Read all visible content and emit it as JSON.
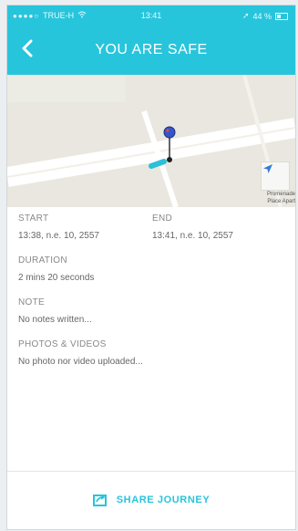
{
  "theme": {
    "accent": "#27c5dc"
  },
  "status_bar": {
    "carrier": "TRUE-H",
    "time": "13:41",
    "battery": "44 %"
  },
  "header": {
    "title": "YOU ARE SAFE"
  },
  "map": {
    "caption_line1": "Promenade",
    "caption_line2": "Place Apart"
  },
  "details": {
    "start_label": "START",
    "start_value": "13:38, n.e. 10, 2557",
    "end_label": "END",
    "end_value": "13:41, n.e. 10, 2557",
    "duration_label": "DURATION",
    "duration_value": "2 mins 20 seconds",
    "note_label": "NOTE",
    "note_value": "No notes written...",
    "media_label": "PHOTOS & VIDEOS",
    "media_value": "No photo nor video uploaded..."
  },
  "footer": {
    "share_label": "SHARE JOURNEY"
  }
}
